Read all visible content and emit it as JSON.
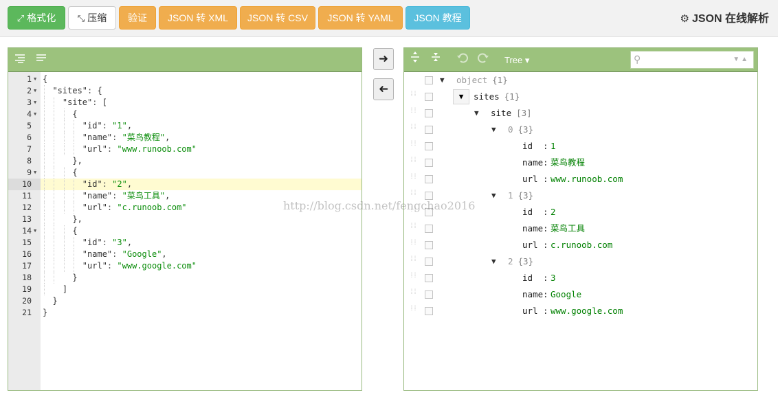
{
  "toolbar": {
    "format_label": "格式化",
    "compress_label": "压缩",
    "validate_label": "验证",
    "to_xml_label": "JSON 转 XML",
    "to_csv_label": "JSON 转 CSV",
    "to_yaml_label": "JSON 转 YAML",
    "tutorial_label": "JSON 教程",
    "brand": "JSON 在线解析"
  },
  "icons": {
    "format": "expand-arrows-icon",
    "compress": "compress-arrows-icon",
    "brand": "gears-icon",
    "code_format": "indent-icon",
    "code_compact": "lines-icon",
    "expand_all": "expand-all-icon",
    "collapse_all": "collapse-all-icon",
    "undo": "undo-icon",
    "redo": "redo-icon",
    "search": "search-icon",
    "to_right": "arrow-right-icon",
    "to_left": "arrow-left-icon"
  },
  "colors": {
    "panel_header": "#9cc27d",
    "green_button": "#5cb85c",
    "orange_button": "#f0ad4e",
    "blue_button": "#5bc0de",
    "string_value": "#0b8d0b",
    "active_line": "#fffbd1"
  },
  "code": {
    "active_line": 10,
    "lines": [
      {
        "n": "1",
        "fold": true,
        "text": "{"
      },
      {
        "n": "2",
        "fold": true,
        "text": "  \"sites\": {"
      },
      {
        "n": "3",
        "fold": true,
        "text": "    \"site\": ["
      },
      {
        "n": "4",
        "fold": true,
        "text": "      {"
      },
      {
        "n": "5",
        "fold": false,
        "text": "        \"id\": \"1\","
      },
      {
        "n": "6",
        "fold": false,
        "text": "        \"name\": \"菜鸟教程\","
      },
      {
        "n": "7",
        "fold": false,
        "text": "        \"url\": \"www.runoob.com\""
      },
      {
        "n": "8",
        "fold": false,
        "text": "      },"
      },
      {
        "n": "9",
        "fold": true,
        "text": "      {"
      },
      {
        "n": "10",
        "fold": false,
        "text": "        \"id\": \"2\","
      },
      {
        "n": "11",
        "fold": false,
        "text": "        \"name\": \"菜鸟工具\","
      },
      {
        "n": "12",
        "fold": false,
        "text": "        \"url\": \"c.runoob.com\""
      },
      {
        "n": "13",
        "fold": false,
        "text": "      },"
      },
      {
        "n": "14",
        "fold": true,
        "text": "      {"
      },
      {
        "n": "15",
        "fold": false,
        "text": "        \"id\": \"3\","
      },
      {
        "n": "16",
        "fold": false,
        "text": "        \"name\": \"Google\","
      },
      {
        "n": "17",
        "fold": false,
        "text": "        \"url\": \"www.google.com\""
      },
      {
        "n": "18",
        "fold": false,
        "text": "      }"
      },
      {
        "n": "19",
        "fold": false,
        "text": "    ]"
      },
      {
        "n": "20",
        "fold": false,
        "text": "  }"
      },
      {
        "n": "21",
        "fold": false,
        "text": "}"
      }
    ]
  },
  "tree": {
    "mode_label": "Tree ▾",
    "search_value": "",
    "rows": [
      {
        "kind": "node",
        "level": 0,
        "field": "object",
        "count": "{1}",
        "gray": true,
        "boxed": false
      },
      {
        "kind": "node",
        "level": 1,
        "field": "sites",
        "count": "{1}",
        "gray": false,
        "boxed": true
      },
      {
        "kind": "node",
        "level": 2,
        "field": "site",
        "count": "[3]",
        "gray": false,
        "boxed": false
      },
      {
        "kind": "node",
        "level": 3,
        "field": "0",
        "count": "{3}",
        "gray": true,
        "boxed": false
      },
      {
        "kind": "leaf",
        "field": "id",
        "value": "1"
      },
      {
        "kind": "leaf",
        "field": "name",
        "value": "菜鸟教程"
      },
      {
        "kind": "leaf",
        "field": "url",
        "value": "www.runoob.com"
      },
      {
        "kind": "node",
        "level": 3,
        "field": "1",
        "count": "{3}",
        "gray": true,
        "boxed": false
      },
      {
        "kind": "leaf",
        "field": "id",
        "value": "2"
      },
      {
        "kind": "leaf",
        "field": "name",
        "value": "菜鸟工具"
      },
      {
        "kind": "leaf",
        "field": "url",
        "value": "c.runoob.com"
      },
      {
        "kind": "node",
        "level": 3,
        "field": "2",
        "count": "{3}",
        "gray": true,
        "boxed": false
      },
      {
        "kind": "leaf",
        "field": "id",
        "value": "3"
      },
      {
        "kind": "leaf",
        "field": "name",
        "value": "Google"
      },
      {
        "kind": "leaf",
        "field": "url",
        "value": "www.google.com"
      }
    ]
  },
  "watermark": "http://blog.csdn.net/fengchao2016"
}
